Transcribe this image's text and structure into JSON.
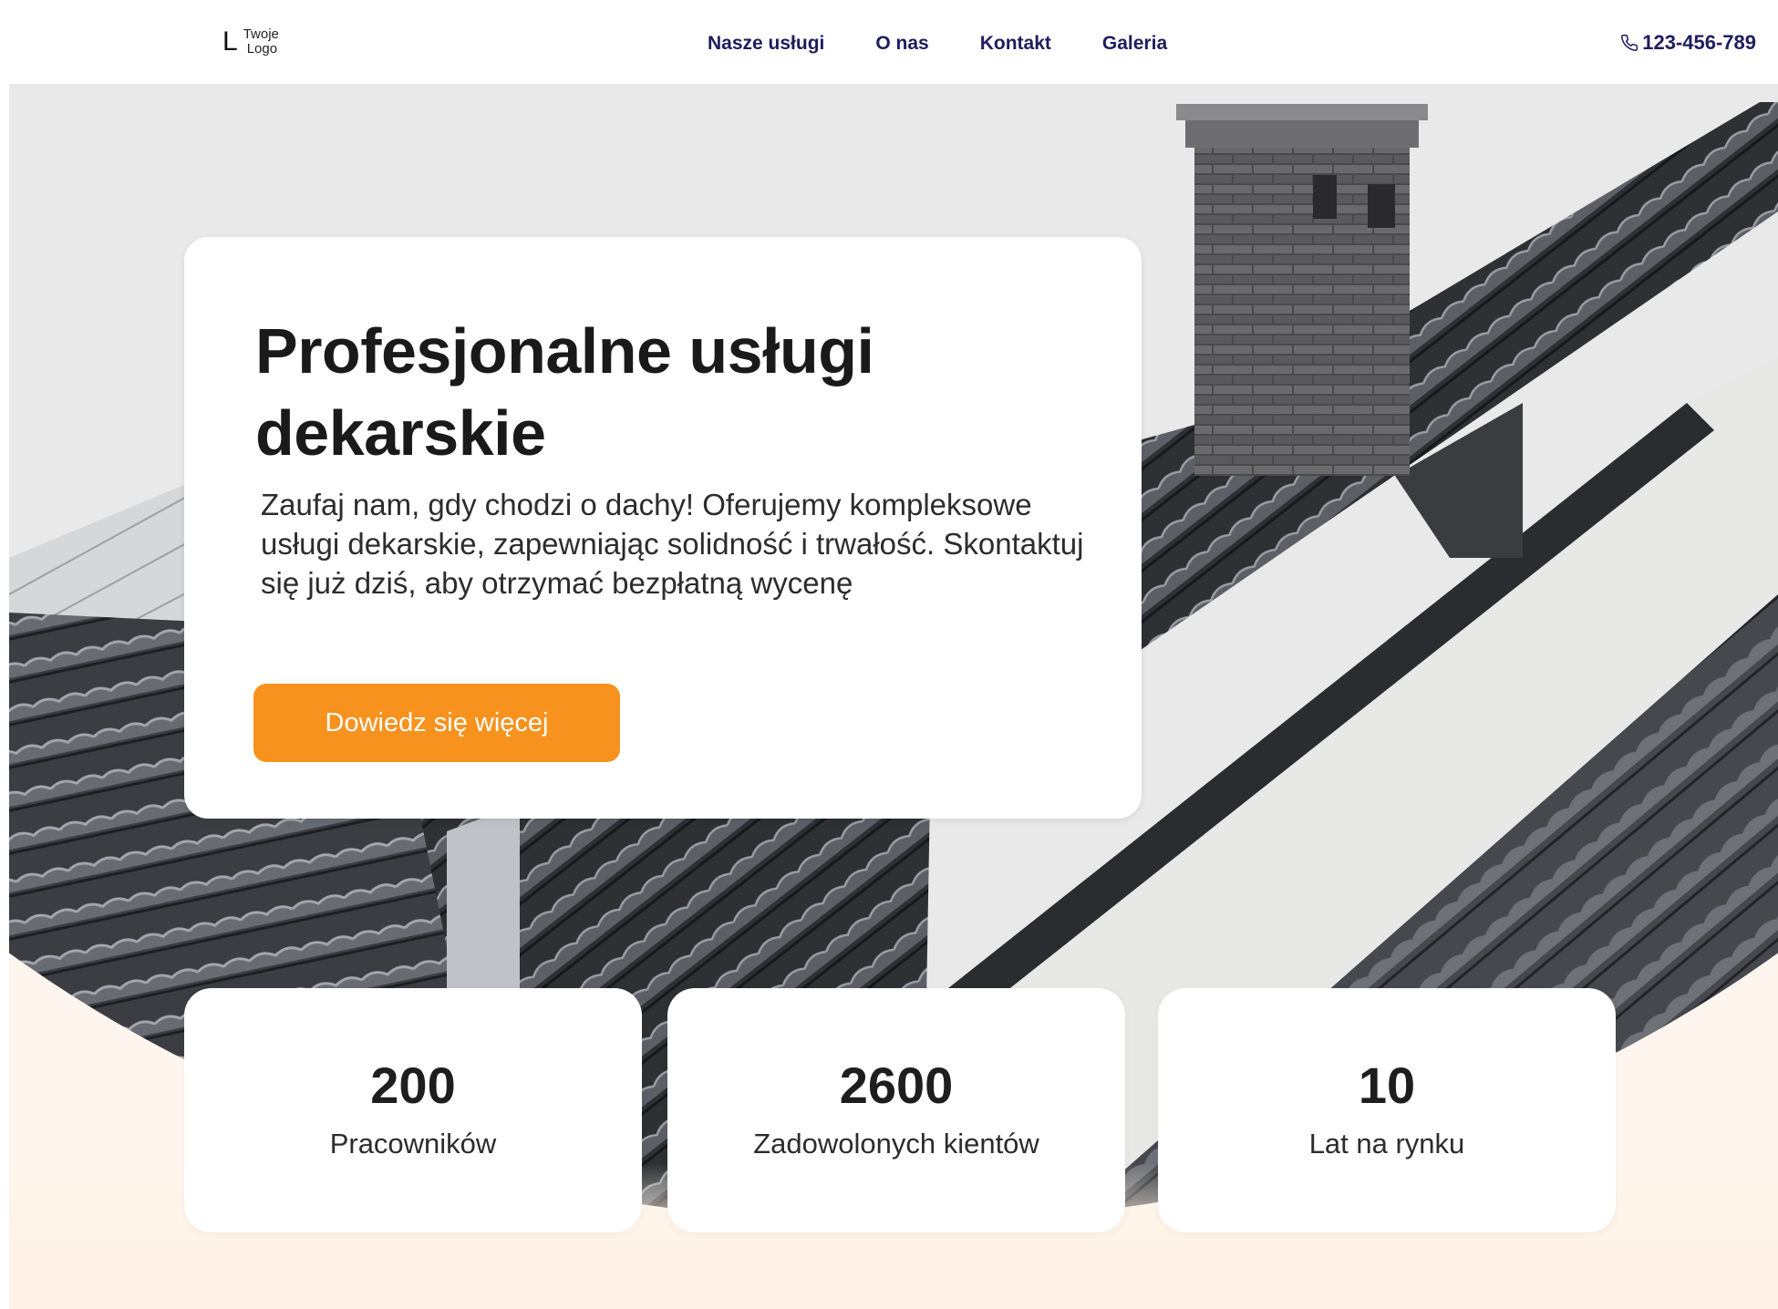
{
  "logo": {
    "mark": "L",
    "line1": "Twoje",
    "line2": "Logo"
  },
  "nav": {
    "items": [
      "Nasze usługi",
      "O nas",
      "Kontakt",
      "Galeria"
    ]
  },
  "phone": {
    "number": "123-456-789"
  },
  "hero": {
    "title_line1": "Profesjonalne usługi",
    "title_line2": "dekarskie",
    "description": "Zaufaj nam, gdy chodzi o dachy! Oferujemy kompleksowe usługi dekarskie, zapewniając solidność i trwałość. Skontaktuj się już dziś, aby otrzymać bezpłatną wycenę",
    "cta_label": "Dowiedz się więcej"
  },
  "stats": [
    {
      "value": "200",
      "label": "Pracowników"
    },
    {
      "value": "2600",
      "label": "Zadowolonych kientów"
    },
    {
      "value": "10",
      "label": "Lat na rynku"
    }
  ],
  "colors": {
    "accent": "#f7921e",
    "nav": "#1f1d5c",
    "background_warm": "#fef3e6"
  }
}
